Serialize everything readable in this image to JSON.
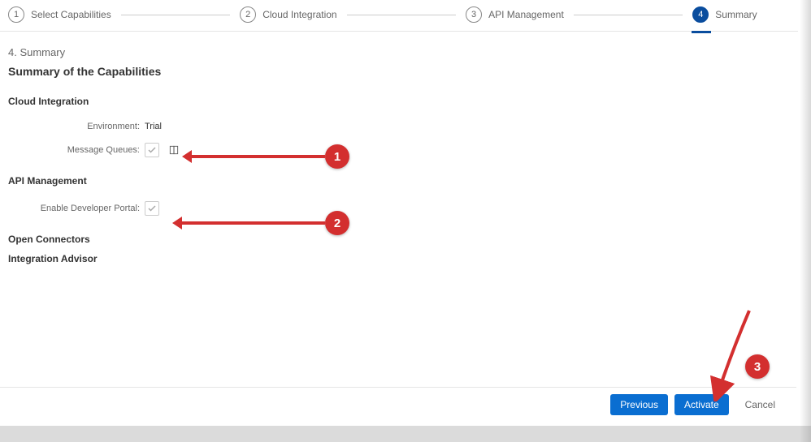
{
  "stepper": {
    "steps": [
      {
        "num": "1",
        "label": "Select Capabilities"
      },
      {
        "num": "2",
        "label": "Cloud Integration"
      },
      {
        "num": "3",
        "label": "API Management"
      },
      {
        "num": "4",
        "label": "Summary"
      }
    ]
  },
  "headings": {
    "step_number": "4. Summary",
    "subtitle": "Summary of the Capabilities"
  },
  "cloud_integration": {
    "title": "Cloud Integration",
    "environment_label": "Environment:",
    "environment_value": "Trial",
    "message_queues_label": "Message Queues:"
  },
  "api_management": {
    "title": "API Management",
    "enable_portal_label": "Enable Developer Portal:"
  },
  "open_connectors": {
    "title": "Open Connectors"
  },
  "integration_advisor": {
    "title": "Integration Advisor"
  },
  "footer": {
    "previous": "Previous",
    "activate": "Activate",
    "cancel": "Cancel"
  },
  "annotations": {
    "one": "1",
    "two": "2",
    "three": "3"
  }
}
